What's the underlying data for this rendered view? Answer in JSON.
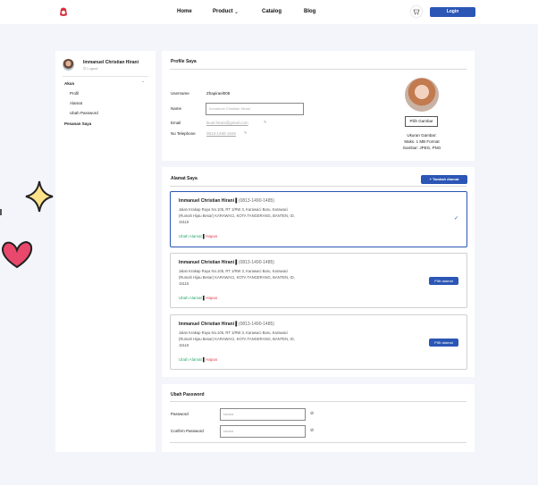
{
  "nav": {
    "home": "Home",
    "product": "Product",
    "catalog": "Catalog",
    "blog": "Blog",
    "login": "Login"
  },
  "sidebar": {
    "user_name": "Immanuel Christian Hirani",
    "logout": "Logout",
    "akun": "Akun",
    "items": [
      "Profil",
      "Alamat",
      "Ubah Password"
    ],
    "pesanan": "Pesanan Saya"
  },
  "profile": {
    "title": "Profile Saya",
    "username_label": "Username",
    "username_value": "Zhapirael008",
    "name_label": "Name",
    "name_value": "Immanuel Christian Hirani",
    "email_label": "Email",
    "email_value": "ikuel.hirani@gmail.com",
    "phone_label": "No Telephone",
    "phone_value": "0813-1490-1845",
    "choose_image": "Pilih Gambar",
    "image_note_1": "Ukuran Gambar:",
    "image_note_2": "Maks. 1 MB Format",
    "image_note_3": "Gambar: JPEG, PNG"
  },
  "address": {
    "title": "Alamat Saya",
    "add_button": "+ Tambah Alamat",
    "cards": [
      {
        "name": "Immanuel Christian Hirani",
        "phone": "(0813-1490-1485)",
        "line1": "Jalan Krakap Raya No.105, RT 1/RW 3, Karawaci Baru, Karawaci",
        "line2": "(Rumah Hijau Besar) KARAWACI, KOTA TANGERANG, BANTEN, ID,",
        "line3": "15116",
        "edit": "Ubah Alamat",
        "delete": "Hapus"
      },
      {
        "name": "Immanuel Christian Hirani",
        "phone": "(0813-1490-1485)",
        "line1": "Jalan Krakap Raya No.105, RT 1/RW 3, Karawaci Baru, Karawaci",
        "line2": "(Rumah Hijau Besar) KARAWACI, KOTA TANGERANG, BANTEN, ID,",
        "line3": "15116",
        "edit": "Ubah Alamat",
        "delete": "Hapus",
        "choose": "Pilih alamat"
      },
      {
        "name": "Immanuel Christian Hirani",
        "phone": "(0813-1490-1485)",
        "line1": "Jalan Krakap Raya No.105, RT 1/RW 3, Karawaci Baru, Karawaci",
        "line2": "(Rumah Hijau Besar) KARAWACI, KOTA TANGERANG, BANTEN, ID,",
        "line3": "15116",
        "edit": "Ubah Alamat",
        "delete": "Hapus",
        "choose": "Pilih alamat"
      }
    ]
  },
  "password": {
    "title": "Ubah Password",
    "password_label": "Password",
    "password_value": "••••••••",
    "confirm_label": "Confirm Password",
    "confirm_value": "••••••••"
  },
  "colors": {
    "primary": "#2b56b5",
    "accent_green": "#2ba76a",
    "accent_red": "#e23a4c"
  }
}
